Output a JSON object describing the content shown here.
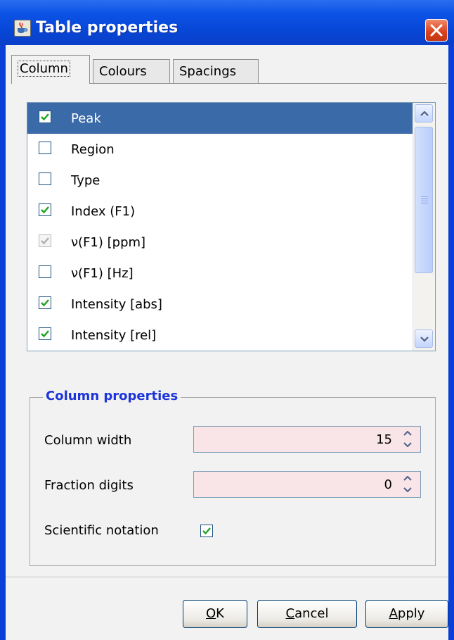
{
  "window": {
    "title": "Table properties"
  },
  "tabs": [
    {
      "label": "Column",
      "active": true
    },
    {
      "label": "Colours",
      "active": false
    },
    {
      "label": "Spacings",
      "active": false
    }
  ],
  "columns_list": {
    "items": [
      {
        "label": "Peak",
        "checked": true,
        "selected": true,
        "enabled": true
      },
      {
        "label": "Region",
        "checked": false,
        "selected": false,
        "enabled": true
      },
      {
        "label": "Type",
        "checked": false,
        "selected": false,
        "enabled": true
      },
      {
        "label": "Index (F1)",
        "checked": true,
        "selected": false,
        "enabled": true
      },
      {
        "label": "ν(F1) [ppm]",
        "checked": true,
        "selected": false,
        "enabled": false
      },
      {
        "label": "ν(F1) [Hz]",
        "checked": false,
        "selected": false,
        "enabled": true
      },
      {
        "label": "Intensity [abs]",
        "checked": true,
        "selected": false,
        "enabled": true
      },
      {
        "label": "Intensity [rel]",
        "checked": true,
        "selected": false,
        "enabled": true
      }
    ]
  },
  "column_properties": {
    "title": "Column properties",
    "column_width": {
      "label": "Column width",
      "value": "15"
    },
    "fraction_digits": {
      "label": "Fraction digits",
      "value": "0"
    },
    "scientific_notation": {
      "label": "Scientific notation",
      "checked": true
    }
  },
  "buttons": {
    "ok": {
      "mnemonic": "O",
      "rest": "K"
    },
    "cancel": {
      "mnemonic": "C",
      "rest": "ancel"
    },
    "apply": {
      "mnemonic": "A",
      "rest": "pply"
    }
  },
  "colors": {
    "selection": "#3b6aa8",
    "group_title": "#1c34d8",
    "spinner_bg": "#f9e4e8",
    "checkmark": "#21a121"
  },
  "icons": [
    "java-cup-icon",
    "close-icon",
    "scroll-up-icon",
    "scroll-down-icon",
    "spinner-up-icon",
    "spinner-down-icon",
    "checkmark-icon"
  ]
}
